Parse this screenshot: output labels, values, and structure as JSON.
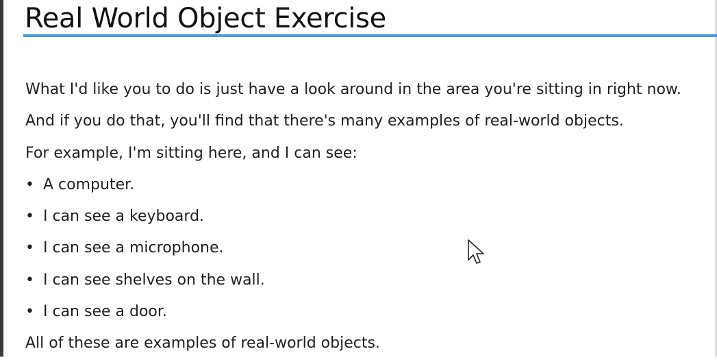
{
  "slide": {
    "title": "Real World Object Exercise",
    "paragraphs": {
      "p1": "What I'd like you to do is just have a look around in the area you're sitting in right now.",
      "p2": "And if you do that, you'll find that there's many examples of real-world objects.",
      "p3": "For example, I'm sitting here, and I can see:"
    },
    "bullets": [
      "A computer.",
      "I can see a keyboard.",
      "I can see a microphone.",
      "I can see shelves on the wall.",
      "I can see a door."
    ],
    "closing": "All of these are examples of real-world objects."
  },
  "colors": {
    "accent_rule": "#4a9be8",
    "text": "#1f1f1f",
    "background": "#ffffff"
  },
  "icons": {
    "cursor": "mouse-pointer-icon"
  }
}
